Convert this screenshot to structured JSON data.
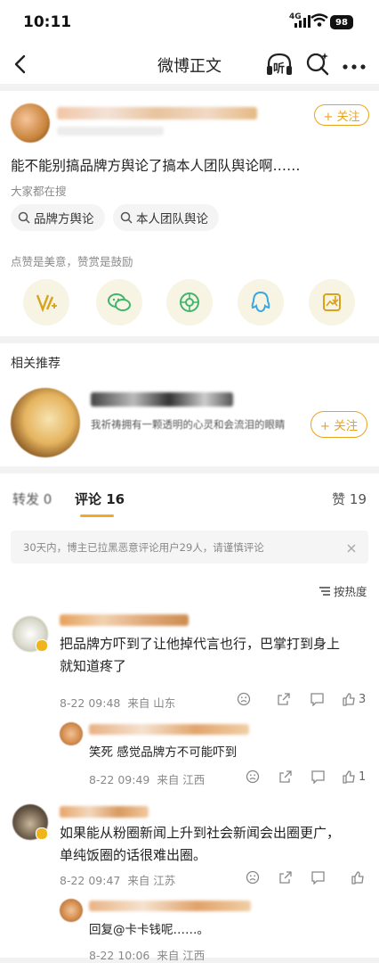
{
  "status": {
    "time": "10:11",
    "network": "4G",
    "battery": "98"
  },
  "nav": {
    "title": "微博正文",
    "listen_label": "听"
  },
  "post": {
    "follow_label": "+ 关注",
    "text": "能不能别搞品牌方舆论了搞本人团队舆论啊……",
    "search_hint": "大家都在搜",
    "chips": [
      "品牌方舆论",
      "本人团队舆论"
    ],
    "reward_hint": "点赞是美意，赞赏是鼓励"
  },
  "related": {
    "heading": "相关推荐",
    "desc": "我祈祷拥有一颗透明的心灵和会流泪的眼睛",
    "follow_label": "+ 关注"
  },
  "tabs": {
    "repost": "转发 0",
    "comments": "评论 16",
    "likes": "赞 19"
  },
  "notice": {
    "text": "30天内，博主已拉黑恶意评论用户29人，请谨慎评论"
  },
  "sort": {
    "label": "按热度"
  },
  "comments": [
    {
      "text_line1": "把品牌方吓到了让他掉代言也行，巴掌打到身上",
      "text_line2": "就知道疼了",
      "date": "8-22 09:48",
      "location": "来自 山东",
      "likes": "3",
      "reply": {
        "text": "笑死 感觉品牌方不可能吓到",
        "date": "8-22 09:49",
        "location": "来自 江西",
        "likes": "1"
      }
    },
    {
      "text_line1": "如果能从粉圈新闻上升到社会新闻会出圈更广，",
      "text_line2": "单纯饭圈的话很难出圈。",
      "date": "8-22 09:47",
      "location": "来自 江苏",
      "likes": "",
      "reply": {
        "text": "回复@卡卡钱呢……。",
        "date": "8-22 10:06",
        "location": "来自 江西"
      }
    }
  ],
  "colors": {
    "accent": "#e9a31a",
    "background": "#f2f2f2"
  }
}
